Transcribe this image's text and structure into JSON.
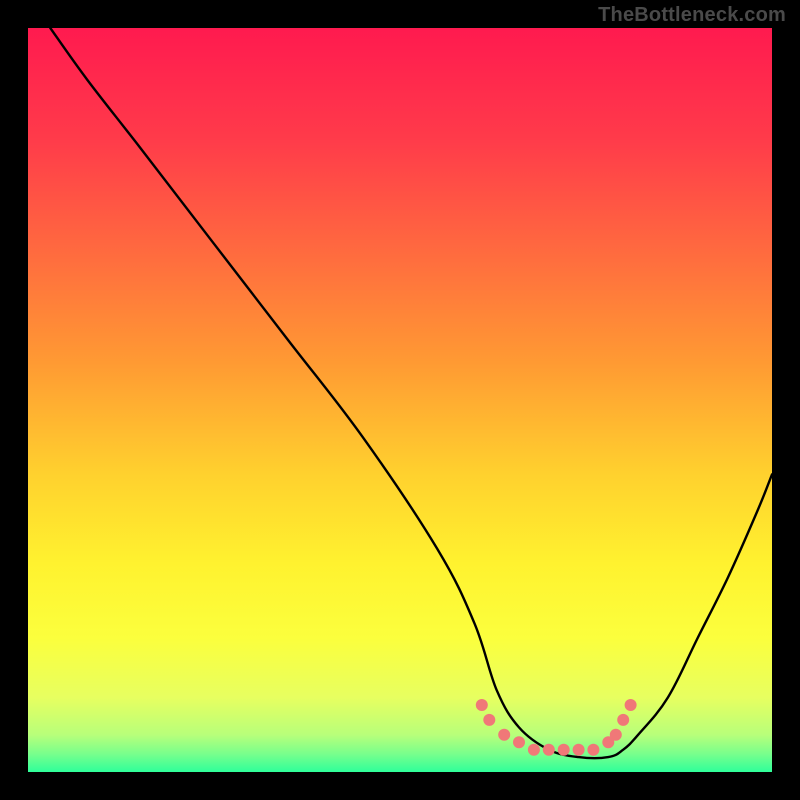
{
  "attribution": "TheBottleneck.com",
  "gradient_stops": [
    {
      "offset": 0.0,
      "color": "#ff1a4f"
    },
    {
      "offset": 0.15,
      "color": "#ff3b4a"
    },
    {
      "offset": 0.3,
      "color": "#ff6a3f"
    },
    {
      "offset": 0.45,
      "color": "#ff9a33"
    },
    {
      "offset": 0.6,
      "color": "#ffd12e"
    },
    {
      "offset": 0.72,
      "color": "#fff22f"
    },
    {
      "offset": 0.82,
      "color": "#fbff3d"
    },
    {
      "offset": 0.9,
      "color": "#e7ff60"
    },
    {
      "offset": 0.95,
      "color": "#b8ff7a"
    },
    {
      "offset": 0.975,
      "color": "#7aff8c"
    },
    {
      "offset": 1.0,
      "color": "#2fff9a"
    }
  ],
  "chart_data": {
    "type": "line",
    "title": "",
    "xlabel": "",
    "ylabel": "",
    "xlim": [
      0,
      100
    ],
    "ylim": [
      0,
      100
    ],
    "grid": false,
    "legend": false,
    "series": [
      {
        "name": "bottleneck-curve",
        "x": [
          3,
          8,
          15,
          25,
          35,
          45,
          55,
          60,
          63,
          66,
          70,
          74,
          78,
          80,
          82,
          86,
          90,
          94,
          98,
          100
        ],
        "y": [
          100,
          93,
          84,
          71,
          58,
          45,
          30,
          20,
          11,
          6,
          3,
          2,
          2,
          3,
          5,
          10,
          18,
          26,
          35,
          40
        ]
      }
    ],
    "markers": {
      "name": "optimal-range-dots",
      "color": "#f07878",
      "points": [
        {
          "x": 61,
          "y": 9
        },
        {
          "x": 62,
          "y": 7
        },
        {
          "x": 64,
          "y": 5
        },
        {
          "x": 66,
          "y": 4
        },
        {
          "x": 68,
          "y": 3
        },
        {
          "x": 70,
          "y": 3
        },
        {
          "x": 72,
          "y": 3
        },
        {
          "x": 74,
          "y": 3
        },
        {
          "x": 76,
          "y": 3
        },
        {
          "x": 78,
          "y": 4
        },
        {
          "x": 79,
          "y": 5
        },
        {
          "x": 80,
          "y": 7
        },
        {
          "x": 81,
          "y": 9
        }
      ]
    }
  }
}
